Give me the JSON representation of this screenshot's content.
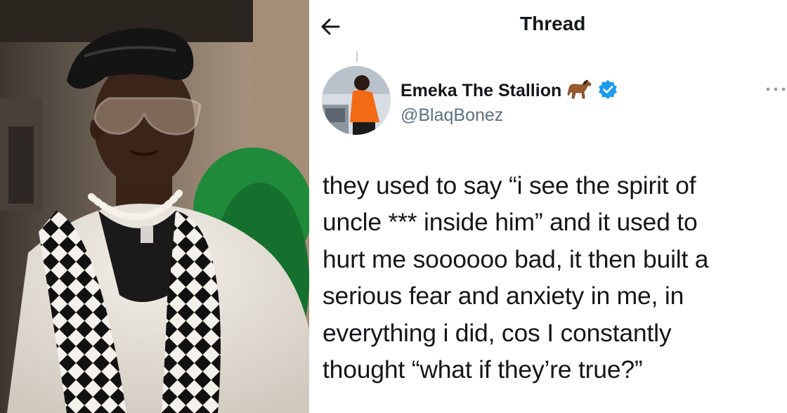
{
  "header": {
    "title": "Thread"
  },
  "tweet": {
    "display_name": "Emeka The Stallion",
    "handle": "@BlaqBonez",
    "text": "they used to say “i see the spirit of\nuncle *** inside him” and it used to\nhurt me soooooo bad, it then built a\nserious fear and anxiety in me, in\neverything i did, cos I constantly\nthought “what if they’re true?”"
  },
  "icons": {
    "back": "back-arrow-icon",
    "horse": "horse-emoji-icon",
    "verified": "verified-badge-icon",
    "more": "more-options-icon"
  },
  "colors": {
    "verified": "#1d9bf0",
    "text": "#14171a",
    "handle": "#5b7083"
  }
}
